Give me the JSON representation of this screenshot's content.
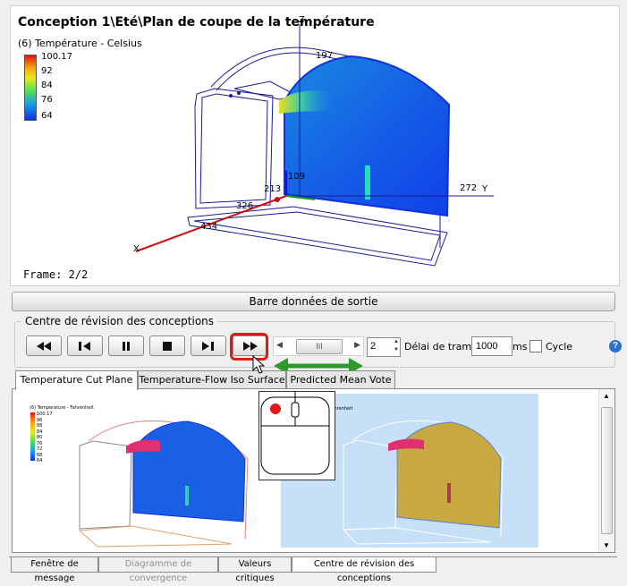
{
  "viewport": {
    "title": "Conception 1\\Eté\\Plan de coupe de la température",
    "legend_title": "(6) Température - Celsius",
    "legend_values": [
      "100.17",
      "92",
      "84",
      "76",
      "64"
    ],
    "frame": "Frame: 2/2",
    "axis_labels": {
      "z": "Z",
      "dim_197": "197",
      "dim_109": "109",
      "dim_272": "272",
      "y": "Y",
      "dim_213": "213",
      "dim_326": "326",
      "dim_434": "434",
      "x": "X"
    }
  },
  "output_bar": {
    "label": "Barre données de sortie"
  },
  "review_center": {
    "title": "Centre de révision des conceptions",
    "buttons": {
      "first": "⏮",
      "prev_frame": "⏴▮",
      "pause": "⏸",
      "stop": "⏹",
      "next_frame": "▮⏵",
      "last": "⏭"
    },
    "slider_thumb": "III",
    "frame_value": "2",
    "delay_label": "Délai de trame :",
    "delay_value": "1000",
    "delay_unit": "ms",
    "cycle_label": "Cycle",
    "help": "?"
  },
  "tabs": [
    "Temperature Cut Plane",
    "Temperature-Flow Iso Surface",
    "Predicted Mean Vote"
  ],
  "thumb_legend": {
    "title": "(6) Temperature - Fahrenheit",
    "values": [
      "100.17",
      "96",
      "88",
      "84",
      "80",
      "76",
      "72",
      "68",
      "64"
    ],
    "right_title": "Fahrenheit"
  },
  "bottom_tabs": [
    "Fenêtre de message",
    "Diagramme de convergence",
    "Valeurs critiques",
    "Centre de révision des conceptions"
  ],
  "colors": {
    "highlight": "#e01818",
    "arrow": "#2e9a2e",
    "help": "#2a70d0"
  }
}
